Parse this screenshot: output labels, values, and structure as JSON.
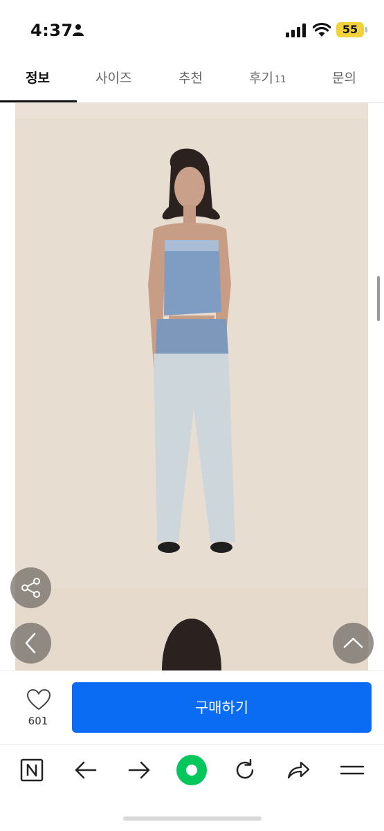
{
  "status_bar": {
    "time": "4:37",
    "battery": "55",
    "icons": [
      "person-icon",
      "signal-icon",
      "wifi-icon",
      "battery-icon"
    ],
    "battery_color": "#f2d23a"
  },
  "tabs": [
    {
      "label": "정보",
      "active": true
    },
    {
      "label": "사이즈"
    },
    {
      "label": "추천"
    },
    {
      "label": "후기",
      "count": "11"
    },
    {
      "label": "문의"
    }
  ],
  "content": {
    "photo_background": "#e8ddd1",
    "floating_buttons": [
      "share-icon",
      "chevron-left-icon",
      "chevron-up-icon"
    ]
  },
  "purchase_bar": {
    "like_count": "601",
    "buy_label": "구매하기",
    "buy_color": "#0a6cf2"
  },
  "browser_toolbar": {
    "icons": [
      "naver-n-icon",
      "arrow-left-icon",
      "arrow-right-icon",
      "green-circle-icon",
      "refresh-icon",
      "share-arrow-icon",
      "menu-icon"
    ],
    "accent": "#03c75a"
  }
}
